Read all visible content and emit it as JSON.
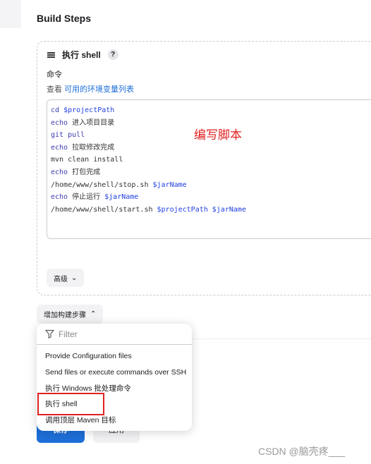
{
  "section_title": "Build Steps",
  "step": {
    "title": "执行 shell",
    "help": "?",
    "command_label": "命令",
    "see_prefix": "查看",
    "env_link": "可用的环境变量列表",
    "code_lines": [
      [
        {
          "t": "cd ",
          "c": "kw"
        },
        {
          "t": "$projectPath",
          "c": "var"
        }
      ],
      [
        {
          "t": "echo",
          "c": "kw"
        },
        {
          "t": " 进入项目目录",
          "c": ""
        }
      ],
      [
        {
          "t": "git pull",
          "c": "kw"
        }
      ],
      [
        {
          "t": "echo",
          "c": "kw"
        },
        {
          "t": " 拉取修改完成",
          "c": ""
        }
      ],
      [
        {
          "t": "mvn clean install",
          "c": ""
        }
      ],
      [
        {
          "t": "echo",
          "c": "kw"
        },
        {
          "t": " 打包完成",
          "c": ""
        }
      ],
      [
        {
          "t": "/home/www/shell/stop.sh ",
          "c": ""
        },
        {
          "t": "$jarName",
          "c": "var"
        }
      ],
      [
        {
          "t": "echo",
          "c": "kw"
        },
        {
          "t": " 停止运行 ",
          "c": ""
        },
        {
          "t": "$jarName",
          "c": "var"
        }
      ],
      [
        {
          "t": "/home/www/shell/start.sh ",
          "c": ""
        },
        {
          "t": "$projectPath",
          "c": "var"
        },
        {
          "t": " ",
          "c": ""
        },
        {
          "t": "$jarName",
          "c": "var"
        }
      ]
    ],
    "annotation": "编写脚本",
    "advanced": "高级"
  },
  "add_step": "增加构建步骤",
  "menu": {
    "filter_placeholder": "Filter",
    "items": [
      "Provide Configuration files",
      "Send files or execute commands over SSH",
      "执行 Windows 批处理命令",
      "执行 shell",
      "调用顶层 Maven 目标"
    ]
  },
  "save": "保存",
  "apply": "应用",
  "watermark": "CSDN @脑壳疼___"
}
